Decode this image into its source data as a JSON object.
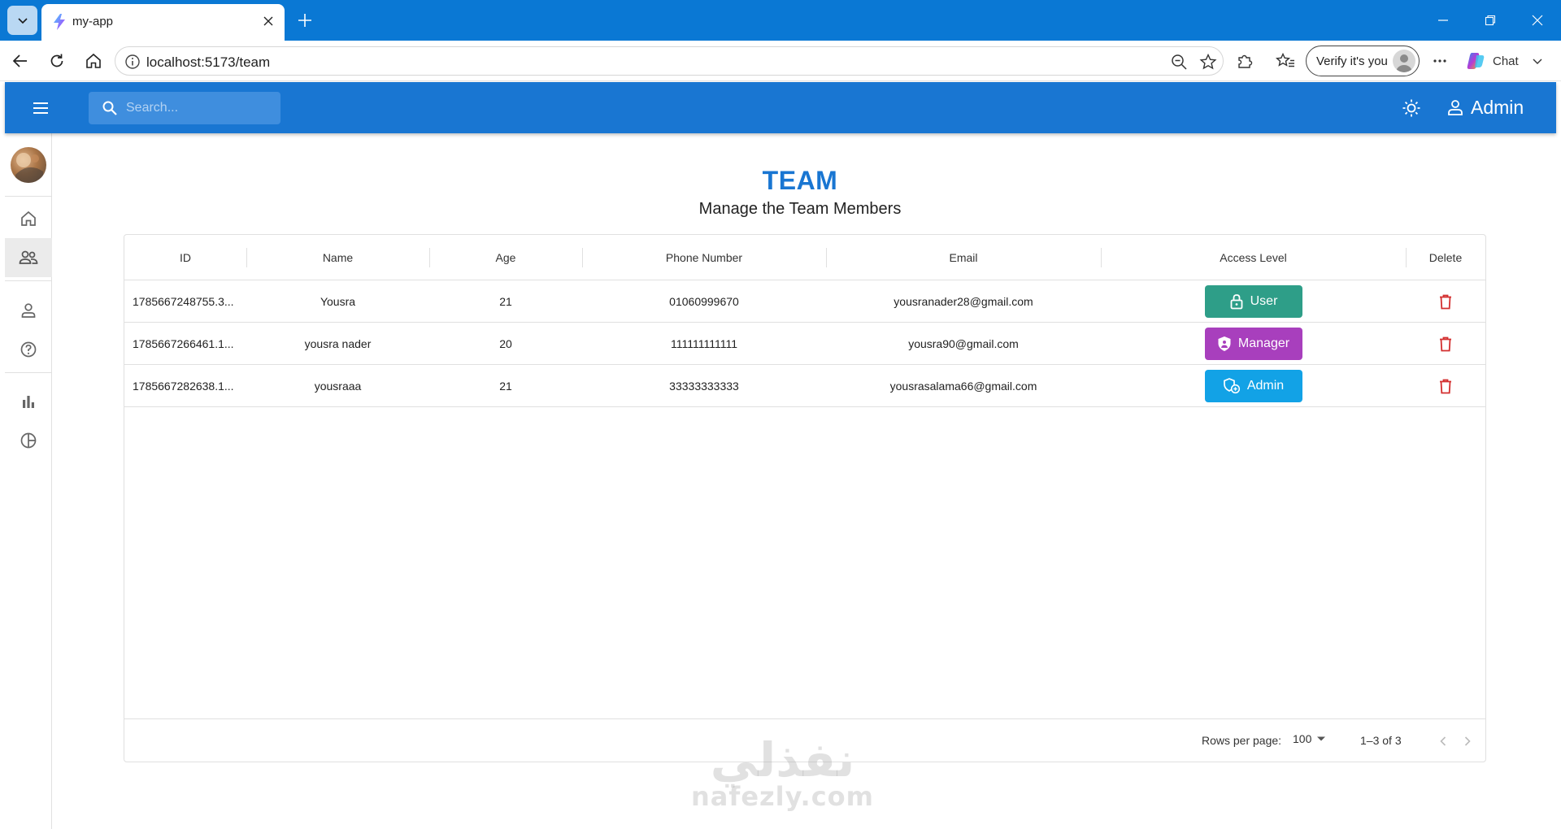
{
  "browser": {
    "tab_title": "my-app",
    "url": "localhost:5173/team",
    "verify_label": "Verify it's you",
    "chat_label": "Chat"
  },
  "appbar": {
    "search_placeholder": "Search...",
    "user_label": "Admin"
  },
  "page": {
    "title": "TEAM",
    "subtitle": "Manage the Team Members"
  },
  "grid": {
    "columns": [
      "ID",
      "Name",
      "Age",
      "Phone Number",
      "Email",
      "Access Level",
      "Delete"
    ],
    "rows": [
      {
        "id": "1785667248755.3...",
        "name": "Yousra",
        "age": "21",
        "phone": "01060999670",
        "email": "yousranader28@gmail.com",
        "access": "User",
        "access_color": "#2e9e88",
        "access_icon": "lock-icon"
      },
      {
        "id": "1785667266461.1...",
        "name": "yousra nader",
        "age": "20",
        "phone": "111111111111",
        "email": "yousra90@gmail.com",
        "access": "Manager",
        "access_color": "#a83fbd",
        "access_icon": "shield-icon"
      },
      {
        "id": "1785667282638.1...",
        "name": "yousraaa",
        "age": "21",
        "phone": "33333333333",
        "email": "yousrasalama66@gmail.com",
        "access": "Admin",
        "access_color": "#12a2e6",
        "access_icon": "admin-icon"
      }
    ],
    "footer": {
      "rows_per_page_label": "Rows per page:",
      "rows_per_page_value": "100",
      "page_info": "1–3 of 3"
    }
  },
  "watermark": {
    "arabic": "نفذلي",
    "latin": "nafezly.com"
  },
  "colors": {
    "appbar": "#1976d2",
    "title": "#1976d2",
    "delete": "#d32f2f"
  }
}
